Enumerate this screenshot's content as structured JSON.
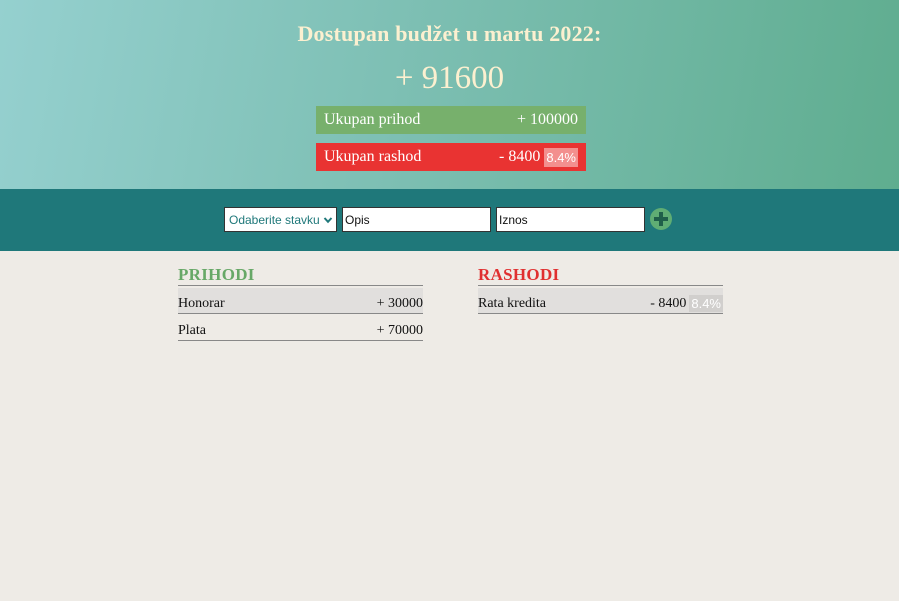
{
  "header": {
    "title": "Dostupan budžet u martu 2022:",
    "available": "+ 91600",
    "income_label": "Ukupan prihod",
    "income_value": "+ 100000",
    "expense_label": "Ukupan rashod",
    "expense_value": "- 8400",
    "expense_percent": "8.4%"
  },
  "form": {
    "type_select": "Odaberite stavku",
    "description_placeholder": "Opis",
    "amount_placeholder": "Iznos",
    "add_icon": "plus-circle-icon"
  },
  "income": {
    "title": "PRIHODI",
    "items": [
      {
        "label": "Honorar",
        "value": "+ 30000"
      },
      {
        "label": "Plata",
        "value": "+ 70000"
      }
    ]
  },
  "expenses": {
    "title": "RASHODI",
    "items": [
      {
        "label": "Rata kredita",
        "value": "- 8400",
        "percent": "8.4%"
      }
    ]
  },
  "colors": {
    "income": "#77b06c",
    "expense": "#e93332",
    "accent": "#1f787a"
  }
}
